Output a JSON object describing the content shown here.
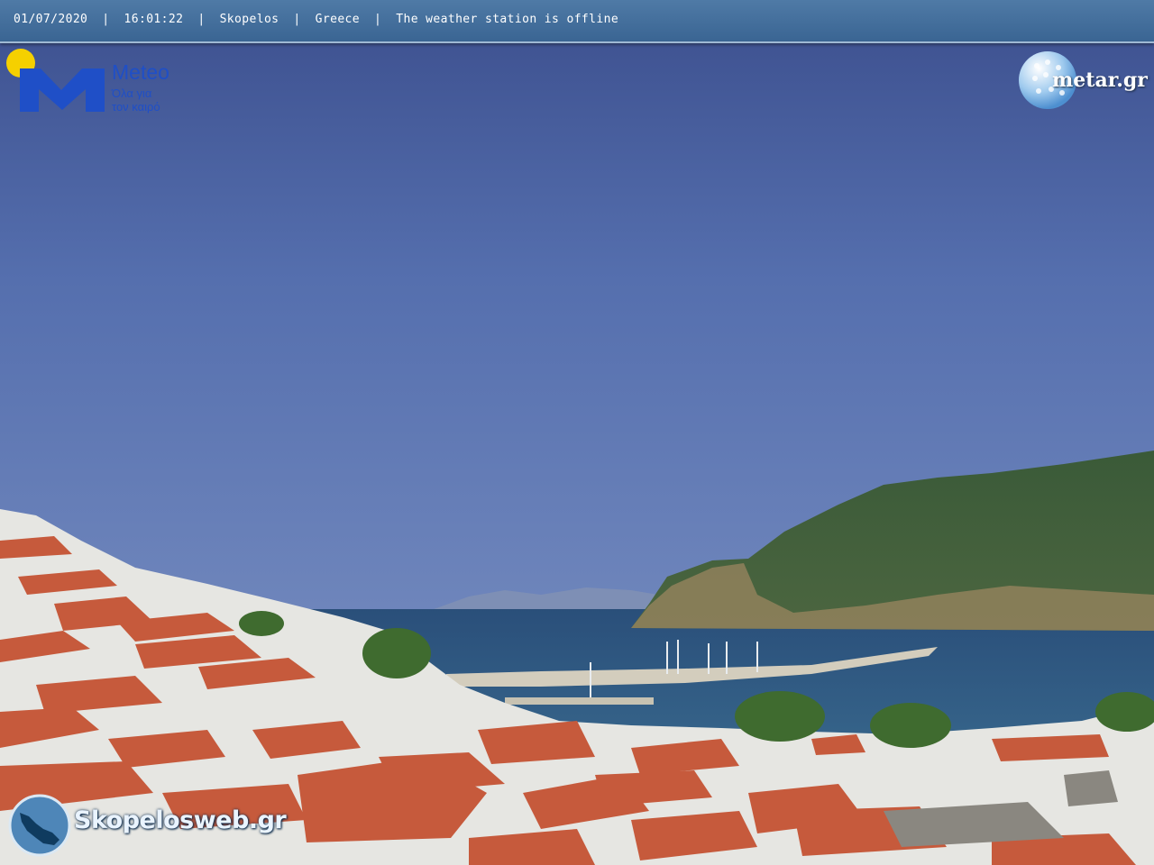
{
  "header": {
    "date": "01/07/2020",
    "time": "16:01:22",
    "location": "Skopelos",
    "country": "Greece",
    "status": "The weather station is offline",
    "separator": "|"
  },
  "logos": {
    "meteo": {
      "name": "Meteo",
      "tagline_1": "Όλα για",
      "tagline_2": "τον καιρό",
      "color": "#1f4fc7",
      "sun_color": "#f5d000"
    },
    "metar": {
      "name": "metar.gr"
    },
    "skopelos": {
      "name": "Skopelosweb.gr"
    }
  },
  "scene": {
    "sky_color": "#5571aa",
    "sea_color": "#2f5d86",
    "hill_color": "#3e5a36",
    "roof_color": "#c65a3c",
    "wall_color": "#eef0f0"
  }
}
